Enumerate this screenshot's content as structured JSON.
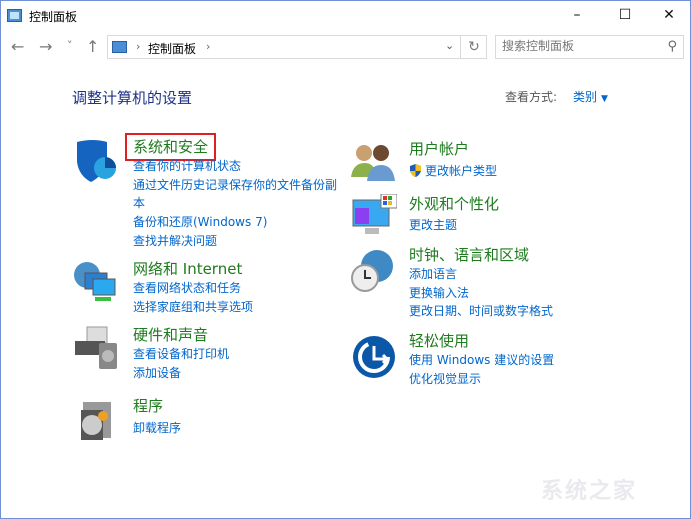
{
  "window": {
    "title": "控制面板",
    "minimize": "–",
    "maximize": "☐",
    "close": "✕"
  },
  "nav": {
    "back": "←",
    "forward": "→",
    "recent": "˅",
    "up": "↑"
  },
  "address": {
    "crumb": "控制面板",
    "sep": "›",
    "dropdown": "⌄",
    "refresh": "↻"
  },
  "search": {
    "placeholder": "搜索控制面板",
    "icon": "⚲"
  },
  "heading": "调整计算机的设置",
  "view": {
    "label": "查看方式:",
    "value": "类别",
    "arrow": "▼"
  },
  "categories_left": [
    {
      "title": "系统和安全",
      "icon": "shield-icon",
      "links": [
        "查看你的计算机状态",
        "通过文件历史记录保存你的文件备份副",
        "本",
        "备份和还原(Windows 7)",
        "查找并解决问题"
      ]
    },
    {
      "title": "网络和 Internet",
      "icon": "network-icon",
      "links": [
        "查看网络状态和任务",
        "选择家庭组和共享选项"
      ]
    },
    {
      "title": "硬件和声音",
      "icon": "printer-icon",
      "links": [
        "查看设备和打印机",
        "添加设备"
      ]
    },
    {
      "title": "程序",
      "icon": "programs-icon",
      "links": [
        "卸载程序"
      ]
    }
  ],
  "categories_right": [
    {
      "title": "用户帐户",
      "icon": "users-icon",
      "links": [
        "更改帐户类型"
      ]
    },
    {
      "title": "外观和个性化",
      "icon": "monitor-icon",
      "links": [
        "更改主题"
      ]
    },
    {
      "title": "时钟、语言和区域",
      "icon": "clock-globe-icon",
      "links": [
        "添加语言",
        "更换输入法",
        "更改日期、时间或数字格式"
      ]
    },
    {
      "title": "轻松使用",
      "icon": "ease-of-access-icon",
      "links": [
        "使用 Windows 建议的设置",
        "优化视觉显示"
      ]
    }
  ],
  "watermark": "系统之家",
  "colors": {
    "title_green": "#1e7b1e",
    "link_blue": "#0066cc",
    "heading_blue": "#1e3287",
    "highlight_red": "#e02020"
  }
}
